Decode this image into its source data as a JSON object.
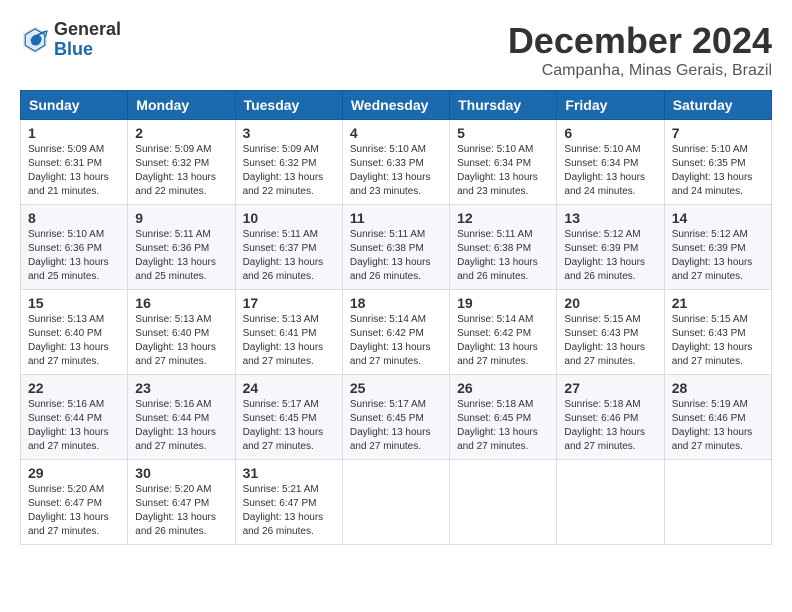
{
  "header": {
    "logo_general": "General",
    "logo_blue": "Blue",
    "month_title": "December 2024",
    "location": "Campanha, Minas Gerais, Brazil"
  },
  "weekdays": [
    "Sunday",
    "Monday",
    "Tuesday",
    "Wednesday",
    "Thursday",
    "Friday",
    "Saturday"
  ],
  "weeks": [
    [
      {
        "day": "1",
        "info": "Sunrise: 5:09 AM\nSunset: 6:31 PM\nDaylight: 13 hours\nand 21 minutes."
      },
      {
        "day": "2",
        "info": "Sunrise: 5:09 AM\nSunset: 6:32 PM\nDaylight: 13 hours\nand 22 minutes."
      },
      {
        "day": "3",
        "info": "Sunrise: 5:09 AM\nSunset: 6:32 PM\nDaylight: 13 hours\nand 22 minutes."
      },
      {
        "day": "4",
        "info": "Sunrise: 5:10 AM\nSunset: 6:33 PM\nDaylight: 13 hours\nand 23 minutes."
      },
      {
        "day": "5",
        "info": "Sunrise: 5:10 AM\nSunset: 6:34 PM\nDaylight: 13 hours\nand 23 minutes."
      },
      {
        "day": "6",
        "info": "Sunrise: 5:10 AM\nSunset: 6:34 PM\nDaylight: 13 hours\nand 24 minutes."
      },
      {
        "day": "7",
        "info": "Sunrise: 5:10 AM\nSunset: 6:35 PM\nDaylight: 13 hours\nand 24 minutes."
      }
    ],
    [
      {
        "day": "8",
        "info": "Sunrise: 5:10 AM\nSunset: 6:36 PM\nDaylight: 13 hours\nand 25 minutes."
      },
      {
        "day": "9",
        "info": "Sunrise: 5:11 AM\nSunset: 6:36 PM\nDaylight: 13 hours\nand 25 minutes."
      },
      {
        "day": "10",
        "info": "Sunrise: 5:11 AM\nSunset: 6:37 PM\nDaylight: 13 hours\nand 26 minutes."
      },
      {
        "day": "11",
        "info": "Sunrise: 5:11 AM\nSunset: 6:38 PM\nDaylight: 13 hours\nand 26 minutes."
      },
      {
        "day": "12",
        "info": "Sunrise: 5:11 AM\nSunset: 6:38 PM\nDaylight: 13 hours\nand 26 minutes."
      },
      {
        "day": "13",
        "info": "Sunrise: 5:12 AM\nSunset: 6:39 PM\nDaylight: 13 hours\nand 26 minutes."
      },
      {
        "day": "14",
        "info": "Sunrise: 5:12 AM\nSunset: 6:39 PM\nDaylight: 13 hours\nand 27 minutes."
      }
    ],
    [
      {
        "day": "15",
        "info": "Sunrise: 5:13 AM\nSunset: 6:40 PM\nDaylight: 13 hours\nand 27 minutes."
      },
      {
        "day": "16",
        "info": "Sunrise: 5:13 AM\nSunset: 6:40 PM\nDaylight: 13 hours\nand 27 minutes."
      },
      {
        "day": "17",
        "info": "Sunrise: 5:13 AM\nSunset: 6:41 PM\nDaylight: 13 hours\nand 27 minutes."
      },
      {
        "day": "18",
        "info": "Sunrise: 5:14 AM\nSunset: 6:42 PM\nDaylight: 13 hours\nand 27 minutes."
      },
      {
        "day": "19",
        "info": "Sunrise: 5:14 AM\nSunset: 6:42 PM\nDaylight: 13 hours\nand 27 minutes."
      },
      {
        "day": "20",
        "info": "Sunrise: 5:15 AM\nSunset: 6:43 PM\nDaylight: 13 hours\nand 27 minutes."
      },
      {
        "day": "21",
        "info": "Sunrise: 5:15 AM\nSunset: 6:43 PM\nDaylight: 13 hours\nand 27 minutes."
      }
    ],
    [
      {
        "day": "22",
        "info": "Sunrise: 5:16 AM\nSunset: 6:44 PM\nDaylight: 13 hours\nand 27 minutes."
      },
      {
        "day": "23",
        "info": "Sunrise: 5:16 AM\nSunset: 6:44 PM\nDaylight: 13 hours\nand 27 minutes."
      },
      {
        "day": "24",
        "info": "Sunrise: 5:17 AM\nSunset: 6:45 PM\nDaylight: 13 hours\nand 27 minutes."
      },
      {
        "day": "25",
        "info": "Sunrise: 5:17 AM\nSunset: 6:45 PM\nDaylight: 13 hours\nand 27 minutes."
      },
      {
        "day": "26",
        "info": "Sunrise: 5:18 AM\nSunset: 6:45 PM\nDaylight: 13 hours\nand 27 minutes."
      },
      {
        "day": "27",
        "info": "Sunrise: 5:18 AM\nSunset: 6:46 PM\nDaylight: 13 hours\nand 27 minutes."
      },
      {
        "day": "28",
        "info": "Sunrise: 5:19 AM\nSunset: 6:46 PM\nDaylight: 13 hours\nand 27 minutes."
      }
    ],
    [
      {
        "day": "29",
        "info": "Sunrise: 5:20 AM\nSunset: 6:47 PM\nDaylight: 13 hours\nand 27 minutes."
      },
      {
        "day": "30",
        "info": "Sunrise: 5:20 AM\nSunset: 6:47 PM\nDaylight: 13 hours\nand 26 minutes."
      },
      {
        "day": "31",
        "info": "Sunrise: 5:21 AM\nSunset: 6:47 PM\nDaylight: 13 hours\nand 26 minutes."
      },
      {
        "day": "",
        "info": ""
      },
      {
        "day": "",
        "info": ""
      },
      {
        "day": "",
        "info": ""
      },
      {
        "day": "",
        "info": ""
      }
    ]
  ]
}
